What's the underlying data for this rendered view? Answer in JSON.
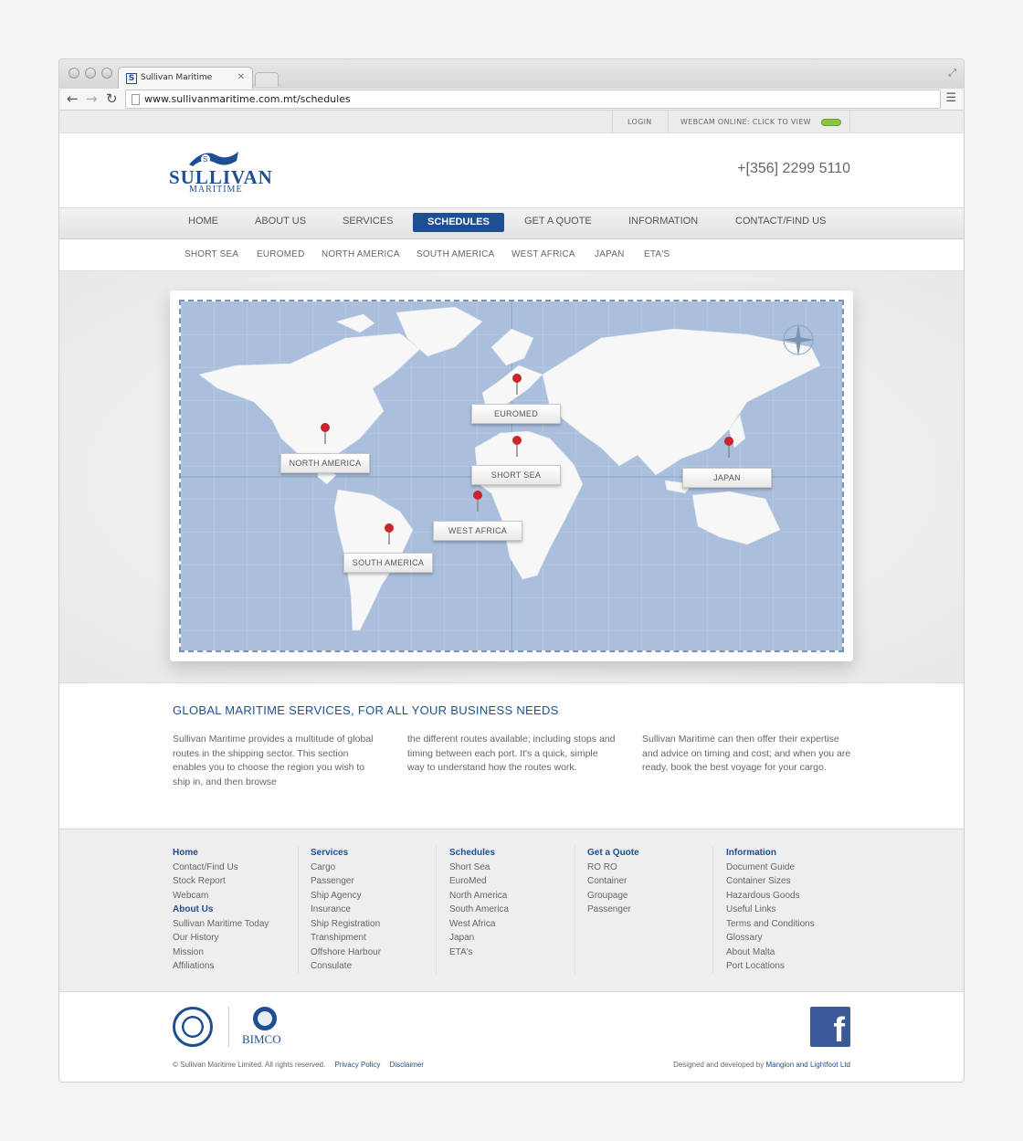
{
  "browser": {
    "tab_title": "Sullivan Maritime",
    "favicon_letter": "S",
    "url": "www.sullivanmaritime.com.mt/schedules"
  },
  "utility": {
    "login": "LOGIN",
    "webcam": "WEBCAM ONLINE: CLICK TO VIEW"
  },
  "header": {
    "logo_name": "SULLIVAN",
    "logo_sub": "MARITIME",
    "phone": "+[356] 2299 5110"
  },
  "mainnav": [
    "HOME",
    "ABOUT US",
    "SERVICES",
    "SCHEDULES",
    "GET A QUOTE",
    "INFORMATION",
    "CONTACT/FIND US"
  ],
  "subnav": [
    "SHORT SEA",
    "EUROMED",
    "NORTH AMERICA",
    "SOUTH AMERICA",
    "WEST AFRICA",
    "JAPAN",
    "ETA'S"
  ],
  "map_labels": {
    "euromed": "EUROMED",
    "north_america": "NORTH AMERICA",
    "short_sea": "SHORT SEA",
    "japan": "JAPAN",
    "west_africa": "WEST AFRICA",
    "south_america": "SOUTH AMERICA"
  },
  "intro": {
    "heading": "GLOBAL MARITIME SERVICES, FOR ALL YOUR BUSINESS NEEDS",
    "col1": "Sullivan Maritime provides a multitude of global routes in the shipping sector. This section enables you to choose the region you wish to ship in, and then browse",
    "col2": "the different routes available; including stops and timing between each port. It's a quick, simple way to understand how the routes work.",
    "col3": "Sullivan Maritime can then offer their expertise and advice on timing and cost; and when you are ready, book the best voyage for your cargo."
  },
  "footer": {
    "col1": [
      {
        "text": "Home",
        "heading": true
      },
      {
        "text": "Contact/Find Us"
      },
      {
        "text": "Stock Report"
      },
      {
        "text": "Webcam"
      },
      {
        "text": "About Us",
        "heading": true
      },
      {
        "text": "Sullivan Maritime Today"
      },
      {
        "text": "Our History"
      },
      {
        "text": "Mission"
      },
      {
        "text": "Affiliations"
      }
    ],
    "col2": [
      {
        "text": "Services",
        "heading": true
      },
      {
        "text": "Cargo"
      },
      {
        "text": "Passenger"
      },
      {
        "text": "Ship Agency"
      },
      {
        "text": "Insurance"
      },
      {
        "text": "Ship Registration"
      },
      {
        "text": "Transhipment"
      },
      {
        "text": "Offshore Harbour"
      },
      {
        "text": "Consulate"
      }
    ],
    "col3": [
      {
        "text": "Schedules",
        "heading": true
      },
      {
        "text": "Short Sea"
      },
      {
        "text": "EuroMed"
      },
      {
        "text": "North America"
      },
      {
        "text": "South America"
      },
      {
        "text": "West Africa"
      },
      {
        "text": "Japan"
      },
      {
        "text": "ETA's"
      }
    ],
    "col4": [
      {
        "text": "Get a Quote",
        "heading": true
      },
      {
        "text": "RO RO"
      },
      {
        "text": "Container"
      },
      {
        "text": "Groupage"
      },
      {
        "text": "Passenger"
      }
    ],
    "col5": [
      {
        "text": "Information",
        "heading": true
      },
      {
        "text": "Document Guide"
      },
      {
        "text": "Container Sizes"
      },
      {
        "text": "Hazardous Goods"
      },
      {
        "text": "Useful Links"
      },
      {
        "text": "Terms and Conditions"
      },
      {
        "text": "Glossary"
      },
      {
        "text": "About Malta"
      },
      {
        "text": "Port Locations"
      }
    ]
  },
  "bottom": {
    "bimco": "BIMCO",
    "copyright": "© Sullivan Maritime Limited. All rights reserved.",
    "privacy": "Privacy Policy",
    "disclaimer": "Disclaimer",
    "credit_prefix": "Designed and developed by",
    "credit_link": "Mangion and Lightfoot Ltd",
    "facebook": "f"
  },
  "colors": {
    "brand_blue": "#1f4f93",
    "map_sea": "#a9bfdc",
    "land": "#f7f7f7",
    "pin": "#c8262b",
    "webcam_led": "#8cc63f",
    "facebook": "#3b5998"
  }
}
